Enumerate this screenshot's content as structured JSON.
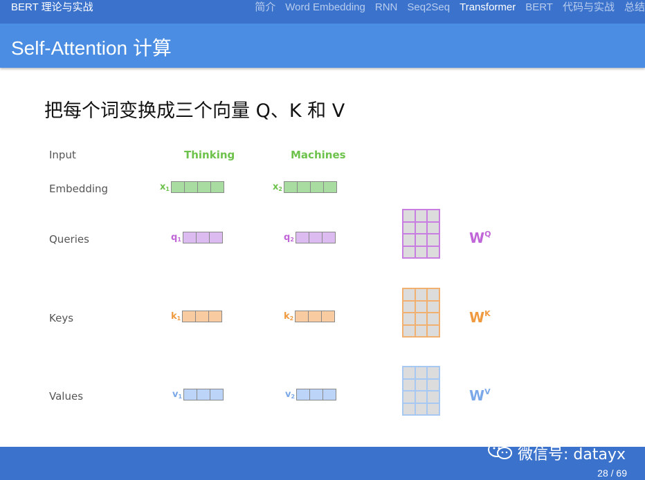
{
  "nav": {
    "brand": "BERT 理论与实战",
    "items": [
      "简介",
      "Word Embedding",
      "RNN",
      "Seq2Seq",
      "Transformer",
      "BERT",
      "代码与实战",
      "总结"
    ],
    "active": "Transformer"
  },
  "title": "Self-Attention 计算",
  "heading": "把每个词变换成三个向量 Q、K 和 V",
  "rows": {
    "input": "Input",
    "embedding": "Embedding",
    "queries": "Queries",
    "keys": "Keys",
    "values": "Values"
  },
  "words": [
    "Thinking",
    "Machines"
  ],
  "vectors": {
    "x1": {
      "letter": "x",
      "sub": "1"
    },
    "x2": {
      "letter": "x",
      "sub": "2"
    },
    "q1": {
      "letter": "q",
      "sub": "1"
    },
    "q2": {
      "letter": "q",
      "sub": "2"
    },
    "k1": {
      "letter": "k",
      "sub": "1"
    },
    "k2": {
      "letter": "k",
      "sub": "2"
    },
    "v1": {
      "letter": "v",
      "sub": "1"
    },
    "v2": {
      "letter": "v",
      "sub": "2"
    }
  },
  "weights": {
    "wq": {
      "base": "W",
      "sup": "Q"
    },
    "wk": {
      "base": "W",
      "sup": "K"
    },
    "wv": {
      "base": "W",
      "sup": "V"
    }
  },
  "colors": {
    "embedding": "#a8dca0",
    "query": "#dcbcf0",
    "key": "#f8cca0",
    "value": "#bcd4f8",
    "query_label": "#c066d8",
    "key_label": "#f09a40",
    "value_label": "#7aa8e8",
    "word": "#6cc24a"
  },
  "footer": {
    "watermark": "微信号: datayx",
    "page": "28 / 69"
  }
}
